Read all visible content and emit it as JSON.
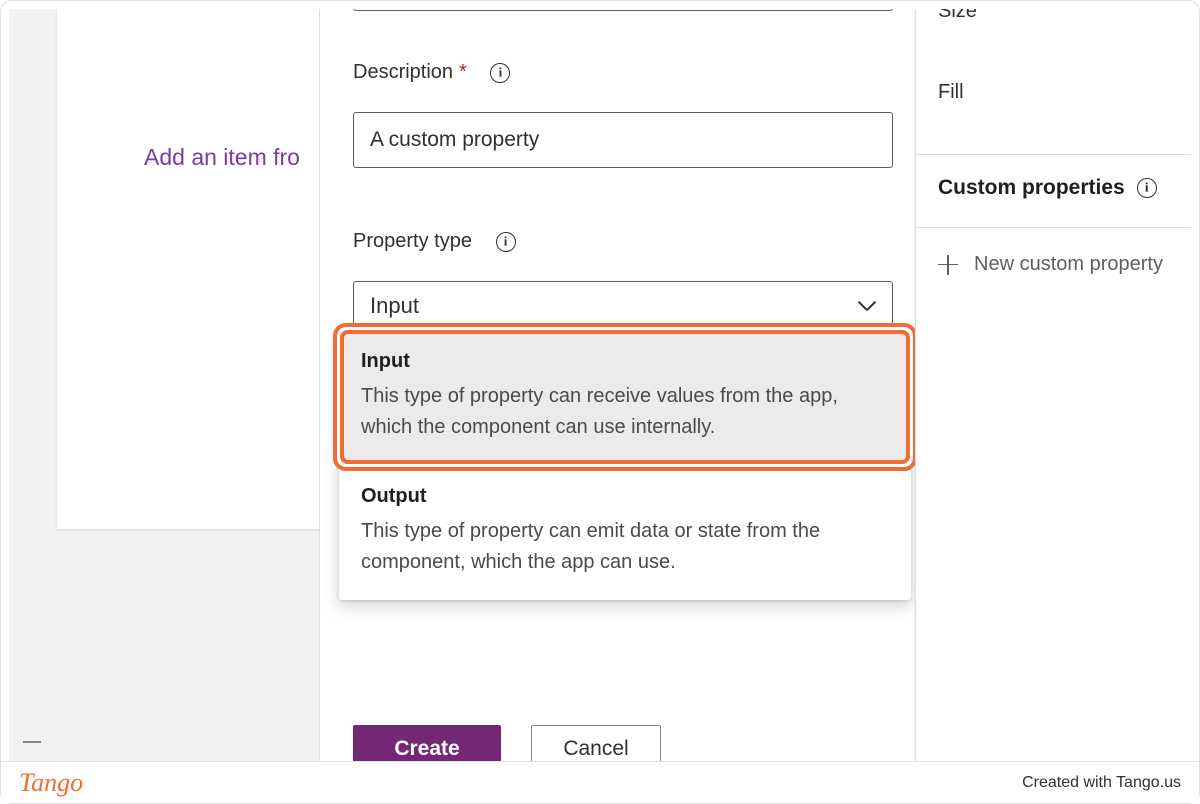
{
  "canvas": {
    "text": "Add an item fro"
  },
  "form": {
    "description_label": "Description",
    "description_value": "A custom property",
    "property_type_label": "Property type",
    "property_type_selected": "Input",
    "options": [
      {
        "title": "Input",
        "description": "This type of property can receive values from the app, which the component can use internally."
      },
      {
        "title": "Output",
        "description": "This type of property can emit data or state from the component, which the app can use."
      }
    ],
    "create_label": "Create",
    "cancel_label": "Cancel"
  },
  "right_panel": {
    "size_label": "Size",
    "fill_label": "Fill",
    "heading": "Custom properties",
    "add_label": "New custom property"
  },
  "footer": {
    "brand": "Tango",
    "attribution": "Created with Tango.us"
  }
}
